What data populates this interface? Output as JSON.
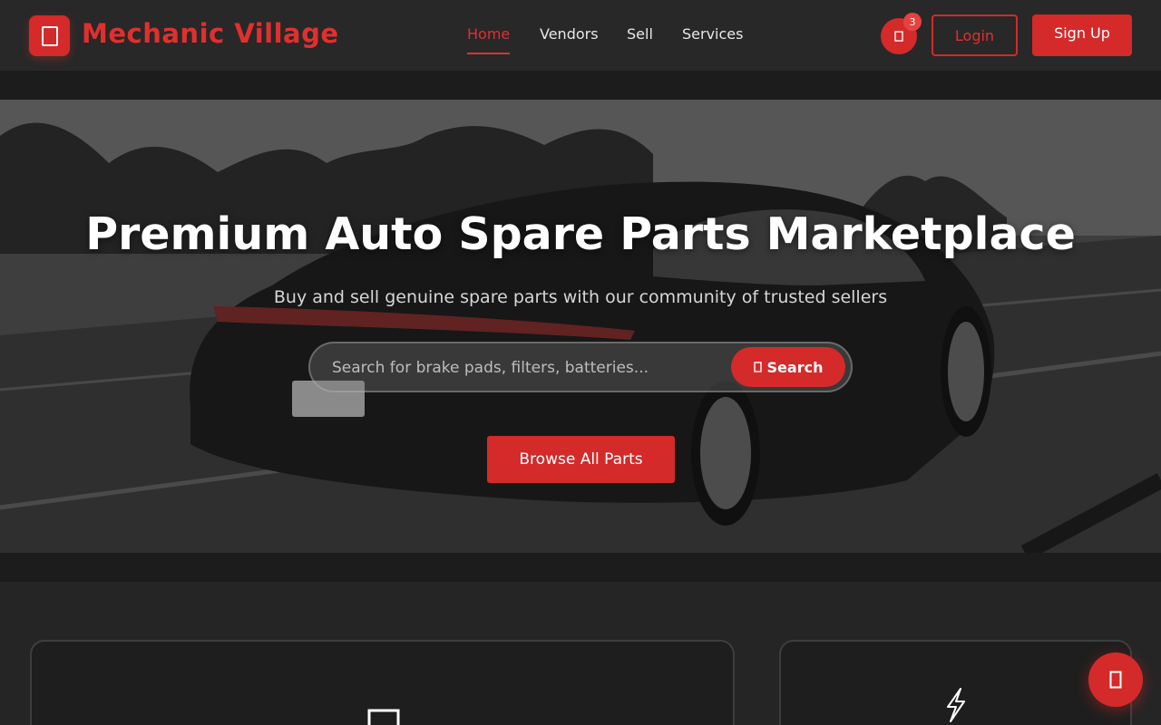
{
  "header": {
    "brand": "Mechanic Village",
    "logo_icon": "wrench-icon",
    "nav": [
      {
        "label": "Home",
        "active": true
      },
      {
        "label": "Vendors",
        "active": false
      },
      {
        "label": "Sell",
        "active": false
      },
      {
        "label": "Services",
        "active": false
      }
    ],
    "cart_icon": "cart-icon",
    "cart_count": "3",
    "login_label": "Login",
    "signup_label": "Sign Up"
  },
  "hero": {
    "title": "Premium Auto Spare Parts Marketplace",
    "subtitle": "Buy and sell genuine spare parts with our community of trusted sellers",
    "search": {
      "placeholder": "Search for brake pads, filters, batteries...",
      "button_label": "Search",
      "button_icon": "search-icon"
    },
    "browse_label": "Browse All Parts",
    "background": "car-photo"
  },
  "features": {
    "cards": [
      {
        "icon": "square-icon"
      },
      {
        "icon": "lightning-icon"
      }
    ]
  },
  "fab_icon": "chat-icon",
  "colors": {
    "accent": "#d42a2a",
    "header_bg": "#282828",
    "page_bg": "#1c1c1c"
  }
}
